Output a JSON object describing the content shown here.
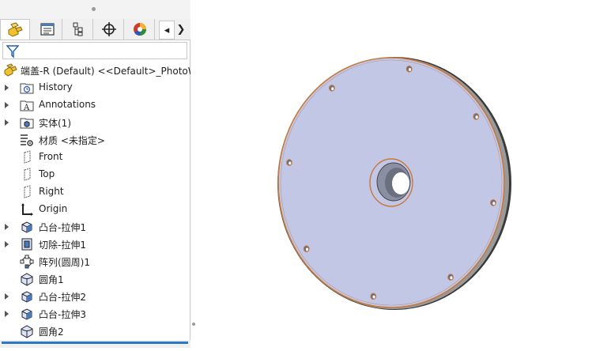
{
  "tabs": [
    {
      "name": "feature-manager",
      "icon": "feature-manager-icon",
      "active": true
    },
    {
      "name": "property-manager",
      "icon": "property-manager-icon",
      "active": false
    },
    {
      "name": "configuration-manager",
      "icon": "configuration-manager-icon",
      "active": false
    },
    {
      "name": "dimxpert-manager",
      "icon": "crosshair-icon",
      "active": false
    },
    {
      "name": "display-manager",
      "icon": "appearance-sphere-icon",
      "active": false
    }
  ],
  "tab_nav": {
    "prev": "◂",
    "next": "❯"
  },
  "filter": {
    "icon": "filter-icon"
  },
  "tree": {
    "root": {
      "label": "端盖-R (Default) <<Default>_PhotoW",
      "icon": "part-icon"
    },
    "items": [
      {
        "label": "History",
        "icon": "history-folder-icon",
        "expandable": true
      },
      {
        "label": "Annotations",
        "icon": "annotations-folder-icon",
        "expandable": true
      },
      {
        "label": "实体(1)",
        "icon": "solid-bodies-folder-icon",
        "expandable": true
      },
      {
        "label": "材质 <未指定>",
        "icon": "material-icon",
        "expandable": false
      },
      {
        "label": "Front",
        "icon": "plane-icon",
        "expandable": false
      },
      {
        "label": "Top",
        "icon": "plane-icon",
        "expandable": false
      },
      {
        "label": "Right",
        "icon": "plane-icon",
        "expandable": false
      },
      {
        "label": "Origin",
        "icon": "origin-icon",
        "expandable": false
      },
      {
        "label": "凸台-拉伸1",
        "icon": "boss-extrude-icon",
        "expandable": true
      },
      {
        "label": "切除-拉伸1",
        "icon": "cut-extrude-icon",
        "expandable": true
      },
      {
        "label": "阵列(圆周)1",
        "icon": "circular-pattern-icon",
        "expandable": false
      },
      {
        "label": "圆角1",
        "icon": "fillet-icon",
        "expandable": false
      },
      {
        "label": "凸台-拉伸2",
        "icon": "boss-extrude-icon",
        "expandable": true
      },
      {
        "label": "凸台-拉伸3",
        "icon": "boss-extrude-icon",
        "expandable": true
      },
      {
        "label": "圆角2",
        "icon": "fillet-icon",
        "expandable": false
      }
    ]
  },
  "model": {
    "face_color": "#c3c7e6",
    "edge_color": "#c8783a",
    "rim_color": "#3a3a3a",
    "bolt_hole_count": 8
  },
  "colors": {
    "accent": "#2a78c4",
    "panel_border": "#c8c8c8"
  }
}
